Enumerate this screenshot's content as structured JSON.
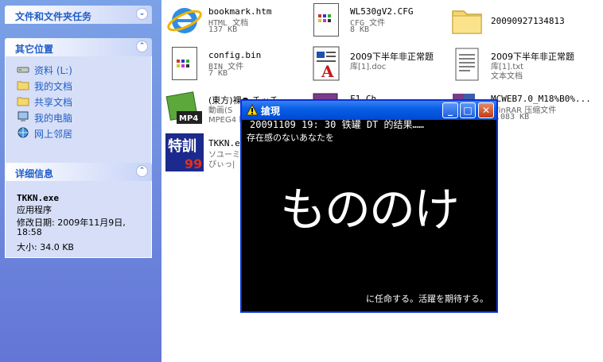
{
  "taskpane": {
    "file_tasks": {
      "title": "文件和文件夹任务"
    },
    "other_places": {
      "title": "其它位置",
      "items": [
        {
          "label": "资料 (L:)",
          "icon": "drive-icon"
        },
        {
          "label": "我的文档",
          "icon": "folder-icon"
        },
        {
          "label": "共享文档",
          "icon": "folder-icon"
        },
        {
          "label": "我的电脑",
          "icon": "computer-icon"
        },
        {
          "label": "网上邻居",
          "icon": "network-icon"
        }
      ]
    },
    "details": {
      "title": "详细信息",
      "name": "TKKN.exe",
      "type": "应用程序",
      "modified_label": "修改日期: 2009年11月9日,",
      "modified_time": "18:58",
      "size": "大小: 34.0 KB"
    }
  },
  "files": [
    {
      "name": "bookmark.htm",
      "type": "HTML 文档",
      "size": "137 KB"
    },
    {
      "name": "WL530gV2.CFG",
      "type": "CFG 文件",
      "size": "8 KB"
    },
    {
      "name": "20090927134813",
      "type": "",
      "size": ""
    },
    {
      "name": "config.bin",
      "type": "BIN 文件",
      "size": "7 KB"
    },
    {
      "name": "2009下半年非正常题",
      "type": "库[1].doc",
      "size": ""
    },
    {
      "name": "2009下半年非正常题",
      "type": "库[1].txt",
      "size": "文本文档"
    },
    {
      "name": "(東方)裸● チッチ…",
      "type": "動画(S",
      "size": "MPEG4 動"
    },
    {
      "name": "F1.Ch…",
      "type": "",
      "size": ""
    },
    {
      "name": "MCWEB7.0_M18%B0%...",
      "type": "WinRAR 压缩文件",
      "size": "3,083 KB"
    },
    {
      "name": "TKKN.ex",
      "type": "ソユーミ",
      "size": "ぴぃっ|"
    }
  ],
  "player": {
    "title": "搶現",
    "subtitle": "20091109 19: 30 铁罐 DT 的结果……",
    "line2": "存在感のないあなたを",
    "big": "もののけ",
    "bottom": "に任命する。活躍を期待する。",
    "min_label": "_",
    "max_label": "□",
    "close_label": "✕"
  }
}
